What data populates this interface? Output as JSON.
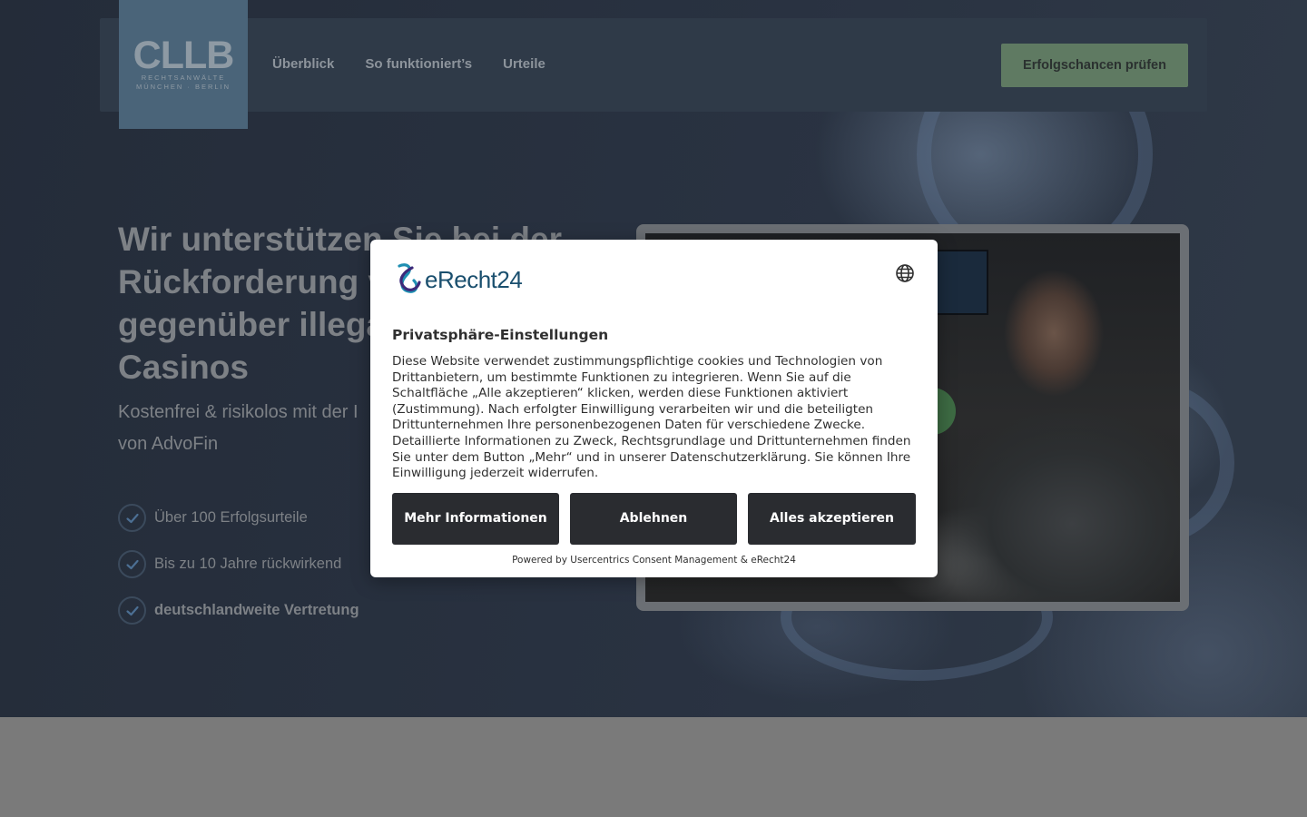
{
  "header": {
    "logo": {
      "text": "CLLB",
      "sub_line1": "RECHTSANWÄLTE",
      "sub_line2": "MÜNCHEN · BERLIN"
    },
    "nav": [
      {
        "label": "Überblick"
      },
      {
        "label": "So funktioniert’s"
      },
      {
        "label": "Urteile"
      }
    ],
    "cta_label": "Erfolgschancen prüfen"
  },
  "hero": {
    "title_lines": [
      "Wir unterstützen Sie bei der",
      "Rückforderung v",
      "gegenüber illega",
      "Casinos"
    ],
    "subtitle_lines": [
      "Kostenfrei & risikolos mit der I",
      "von AdvoFin"
    ],
    "checks": [
      {
        "label": "Über 100 Erfolgsurteile"
      },
      {
        "label": "Bis zu 10 Jahre rückwirkend"
      },
      {
        "label": "deutschlandweite Vertretung"
      }
    ]
  },
  "consent": {
    "brand": "eRecht24",
    "title": "Privatsphäre-Einstellungen",
    "body": "Diese Website verwendet zustimmungspflichtige cookies und Technologien von Drittanbietern, um bestimmte Funktionen zu integrieren. Wenn Sie auf die Schaltfläche „Alle akzeptieren“ klicken, werden diese Funktionen aktiviert (Zustimmung). Nach erfolgter Einwilligung verarbeiten wir und die beteiligten Drittunternehmen Ihre personenbezogenen Daten für verschiedene Zwecke. Detaillierte Informationen zu Zweck, Rechtsgrundlage und Drittunternehmen finden Sie unter dem Button „Mehr“ und in unserer Datenschutzerklärung. Sie können Ihre Einwilligung jederzeit widerrufen.",
    "buttons": {
      "more": "Mehr Informationen",
      "reject": "Ablehnen",
      "accept": "Alles akzeptieren"
    },
    "powered_by": "Powered by Usercentrics Consent Management & eRecht24"
  },
  "colors": {
    "cta_bg": "#5f7a62",
    "logo_bg": "#4a6479",
    "button_dark": "#2a2c30",
    "brand_teal": "#1a4f6e"
  },
  "icons": [
    "logo",
    "check-icon",
    "globe-icon",
    "erecht24-mark-icon",
    "play-icon"
  ]
}
